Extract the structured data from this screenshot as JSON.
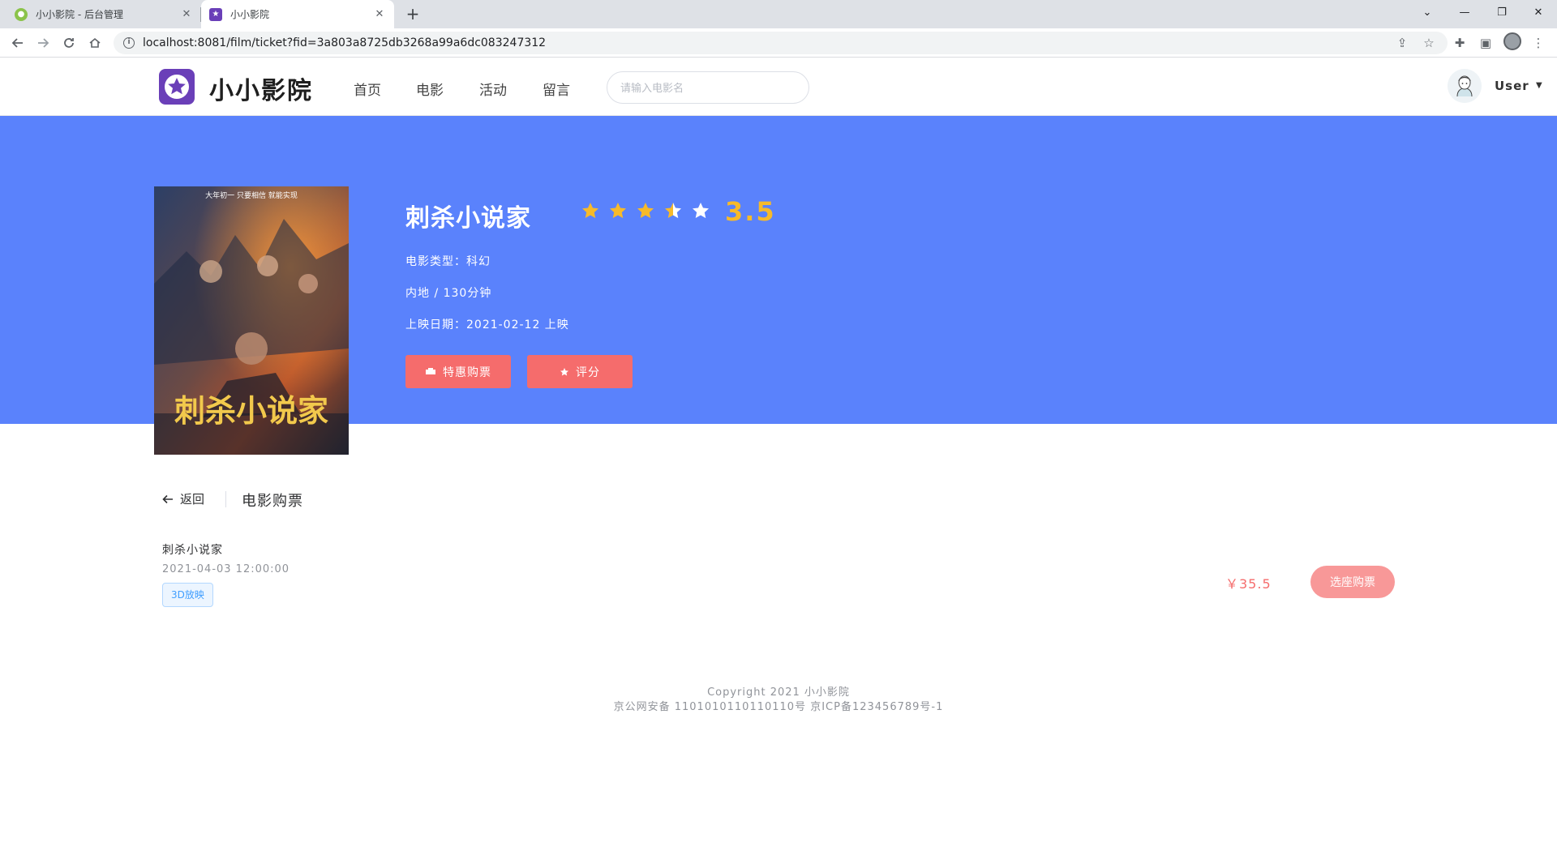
{
  "browser": {
    "tabs": [
      {
        "title": "小小影院 - 后台管理"
      },
      {
        "title": "小小影院"
      }
    ],
    "url": "localhost:8081/film/ticket?fid=3a803a8725db3268a99a6dc083247312"
  },
  "site": {
    "logo_text": "小小影院",
    "nav": [
      "首页",
      "电影",
      "活动",
      "留言"
    ],
    "search_placeholder": "请输入电影名",
    "user_name": "User"
  },
  "film": {
    "title": "刺杀小说家",
    "rating": "3.5",
    "genre": "电影类型：科幻",
    "region_duration": "内地 / 130分钟",
    "release": "上映日期：2021-02-12 上映",
    "poster_title": "刺杀小说家",
    "poster_tagline": "大年初一 只要相信 就能实现",
    "buy_label": "特惠购票",
    "rate_label": "评分"
  },
  "content": {
    "back_label": "返回",
    "page_title": "电影购票",
    "ticket": {
      "name": "刺杀小说家",
      "time": "2021-04-03 12:00:00",
      "tag": "3D放映",
      "price": "￥35.5",
      "select_label": "选座购票"
    }
  },
  "footer": {
    "line1": "Copyright 2021 小小影院",
    "line2": "京公网安备 1101010110110110号 京ICP备123456789号-1"
  },
  "colors": {
    "hero_bg": "#5a82fc",
    "accent_red": "#f56c6c",
    "star_gold": "#f7ba2a",
    "logo_purple": "#6a3fb8"
  }
}
